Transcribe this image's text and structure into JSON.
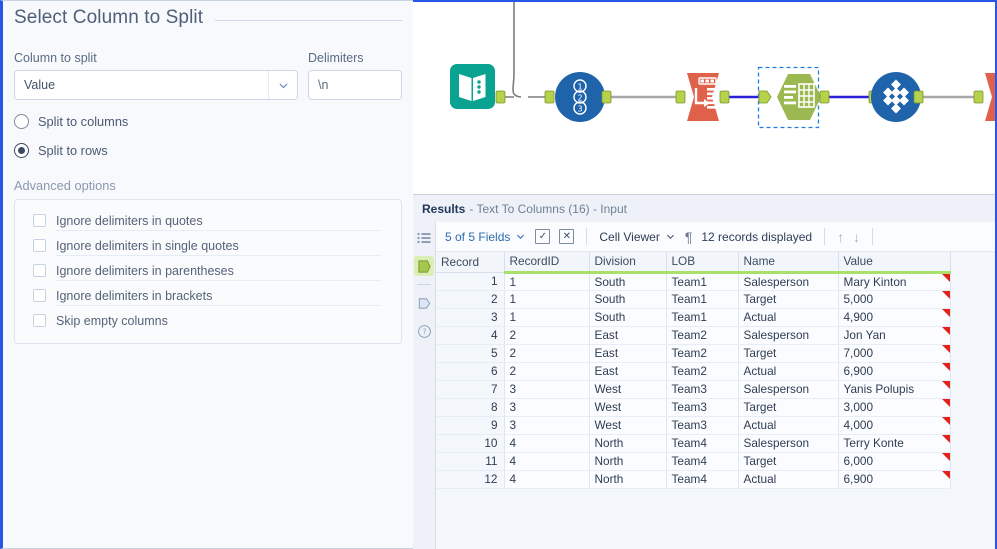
{
  "config_panel": {
    "title": "Select Column to Split",
    "column_label": "Column to split",
    "column_value": "Value",
    "delimiters_label": "Delimiters",
    "delimiters_value": "\\n",
    "radios": [
      {
        "label": "Split to columns",
        "checked": false
      },
      {
        "label": "Split to rows",
        "checked": true
      }
    ],
    "advanced_title": "Advanced options",
    "advanced_options": [
      {
        "label": "Ignore delimiters in quotes",
        "checked": false,
        "underlined": true
      },
      {
        "label": "Ignore delimiters in single quotes",
        "checked": false,
        "underlined": true
      },
      {
        "label": "Ignore delimiters in parentheses",
        "checked": false,
        "underlined": true
      },
      {
        "label": "Ignore delimiters in brackets",
        "checked": false,
        "underlined": true
      },
      {
        "label": "Skip empty columns",
        "checked": false,
        "underlined": false
      }
    ]
  },
  "canvas": {
    "tools": [
      {
        "name": "input-data-tool",
        "icon": "book-icon",
        "color": "#0aa391"
      },
      {
        "name": "record-id-tool",
        "icon": "numbers-123-icon",
        "color": "#1f64ab"
      },
      {
        "name": "text-to-columns-tool",
        "icon": "text-to-columns-icon",
        "color": "#e0614a"
      },
      {
        "name": "select-tool",
        "icon": "table-select-icon",
        "color": "#9cb850",
        "selected": true
      },
      {
        "name": "cross-tab-tool",
        "icon": "diamond-grid-icon",
        "color": "#1f64ab"
      },
      {
        "name": "browse-tool",
        "icon": "output-icon",
        "color": "#e0614a"
      }
    ]
  },
  "results": {
    "header_title": "Results",
    "header_subtitle": "- Text To Columns (16) - Input",
    "toolbar": {
      "fields_label": "5 of 5 Fields",
      "check_icon": "checkbox-check-icon",
      "clear_icon": "checkbox-clear-icon",
      "viewer_label": "Cell Viewer",
      "pilcrow_icon": "pilcrow-icon",
      "records_label": "12 records displayed",
      "up_icon": "arrow-up-icon",
      "down_icon": "arrow-down-icon"
    },
    "rail": [
      {
        "name": "list-icon",
        "active": false
      },
      {
        "name": "data-output-icon",
        "active": true
      },
      {
        "name": "metadata-icon",
        "active": false
      },
      {
        "name": "help-icon",
        "active": false
      }
    ],
    "table": {
      "columns": [
        "Record",
        "RecordID",
        "Division",
        "LOB",
        "Name",
        "Value"
      ],
      "rows": [
        [
          "1",
          "1",
          "South",
          "Team1",
          "Salesperson",
          "Mary Kinton"
        ],
        [
          "2",
          "1",
          "South",
          "Team1",
          "Target",
          "5,000"
        ],
        [
          "3",
          "1",
          "South",
          "Team1",
          "Actual",
          "4,900"
        ],
        [
          "4",
          "2",
          "East",
          "Team2",
          "Salesperson",
          "Jon Yan"
        ],
        [
          "5",
          "2",
          "East",
          "Team2",
          "Target",
          "7,000"
        ],
        [
          "6",
          "2",
          "East",
          "Team2",
          "Actual",
          "6,900"
        ],
        [
          "7",
          "3",
          "West",
          "Team3",
          "Salesperson",
          "Yanis Polupis"
        ],
        [
          "8",
          "3",
          "West",
          "Team3",
          "Target",
          "3,000"
        ],
        [
          "9",
          "3",
          "West",
          "Team3",
          "Actual",
          "4,000"
        ],
        [
          "10",
          "4",
          "North",
          "Team4",
          "Salesperson",
          "Terry Konte"
        ],
        [
          "11",
          "4",
          "North",
          "Team4",
          "Target",
          "6,000"
        ],
        [
          "12",
          "4",
          "North",
          "Team4",
          "Actual",
          "6,900"
        ]
      ]
    }
  },
  "colors": {
    "accent_blue": "#2a55e5",
    "header_underline_green": "#a8e06a",
    "flag_red": "#e32119",
    "link_blue": "#2b6cb0"
  }
}
